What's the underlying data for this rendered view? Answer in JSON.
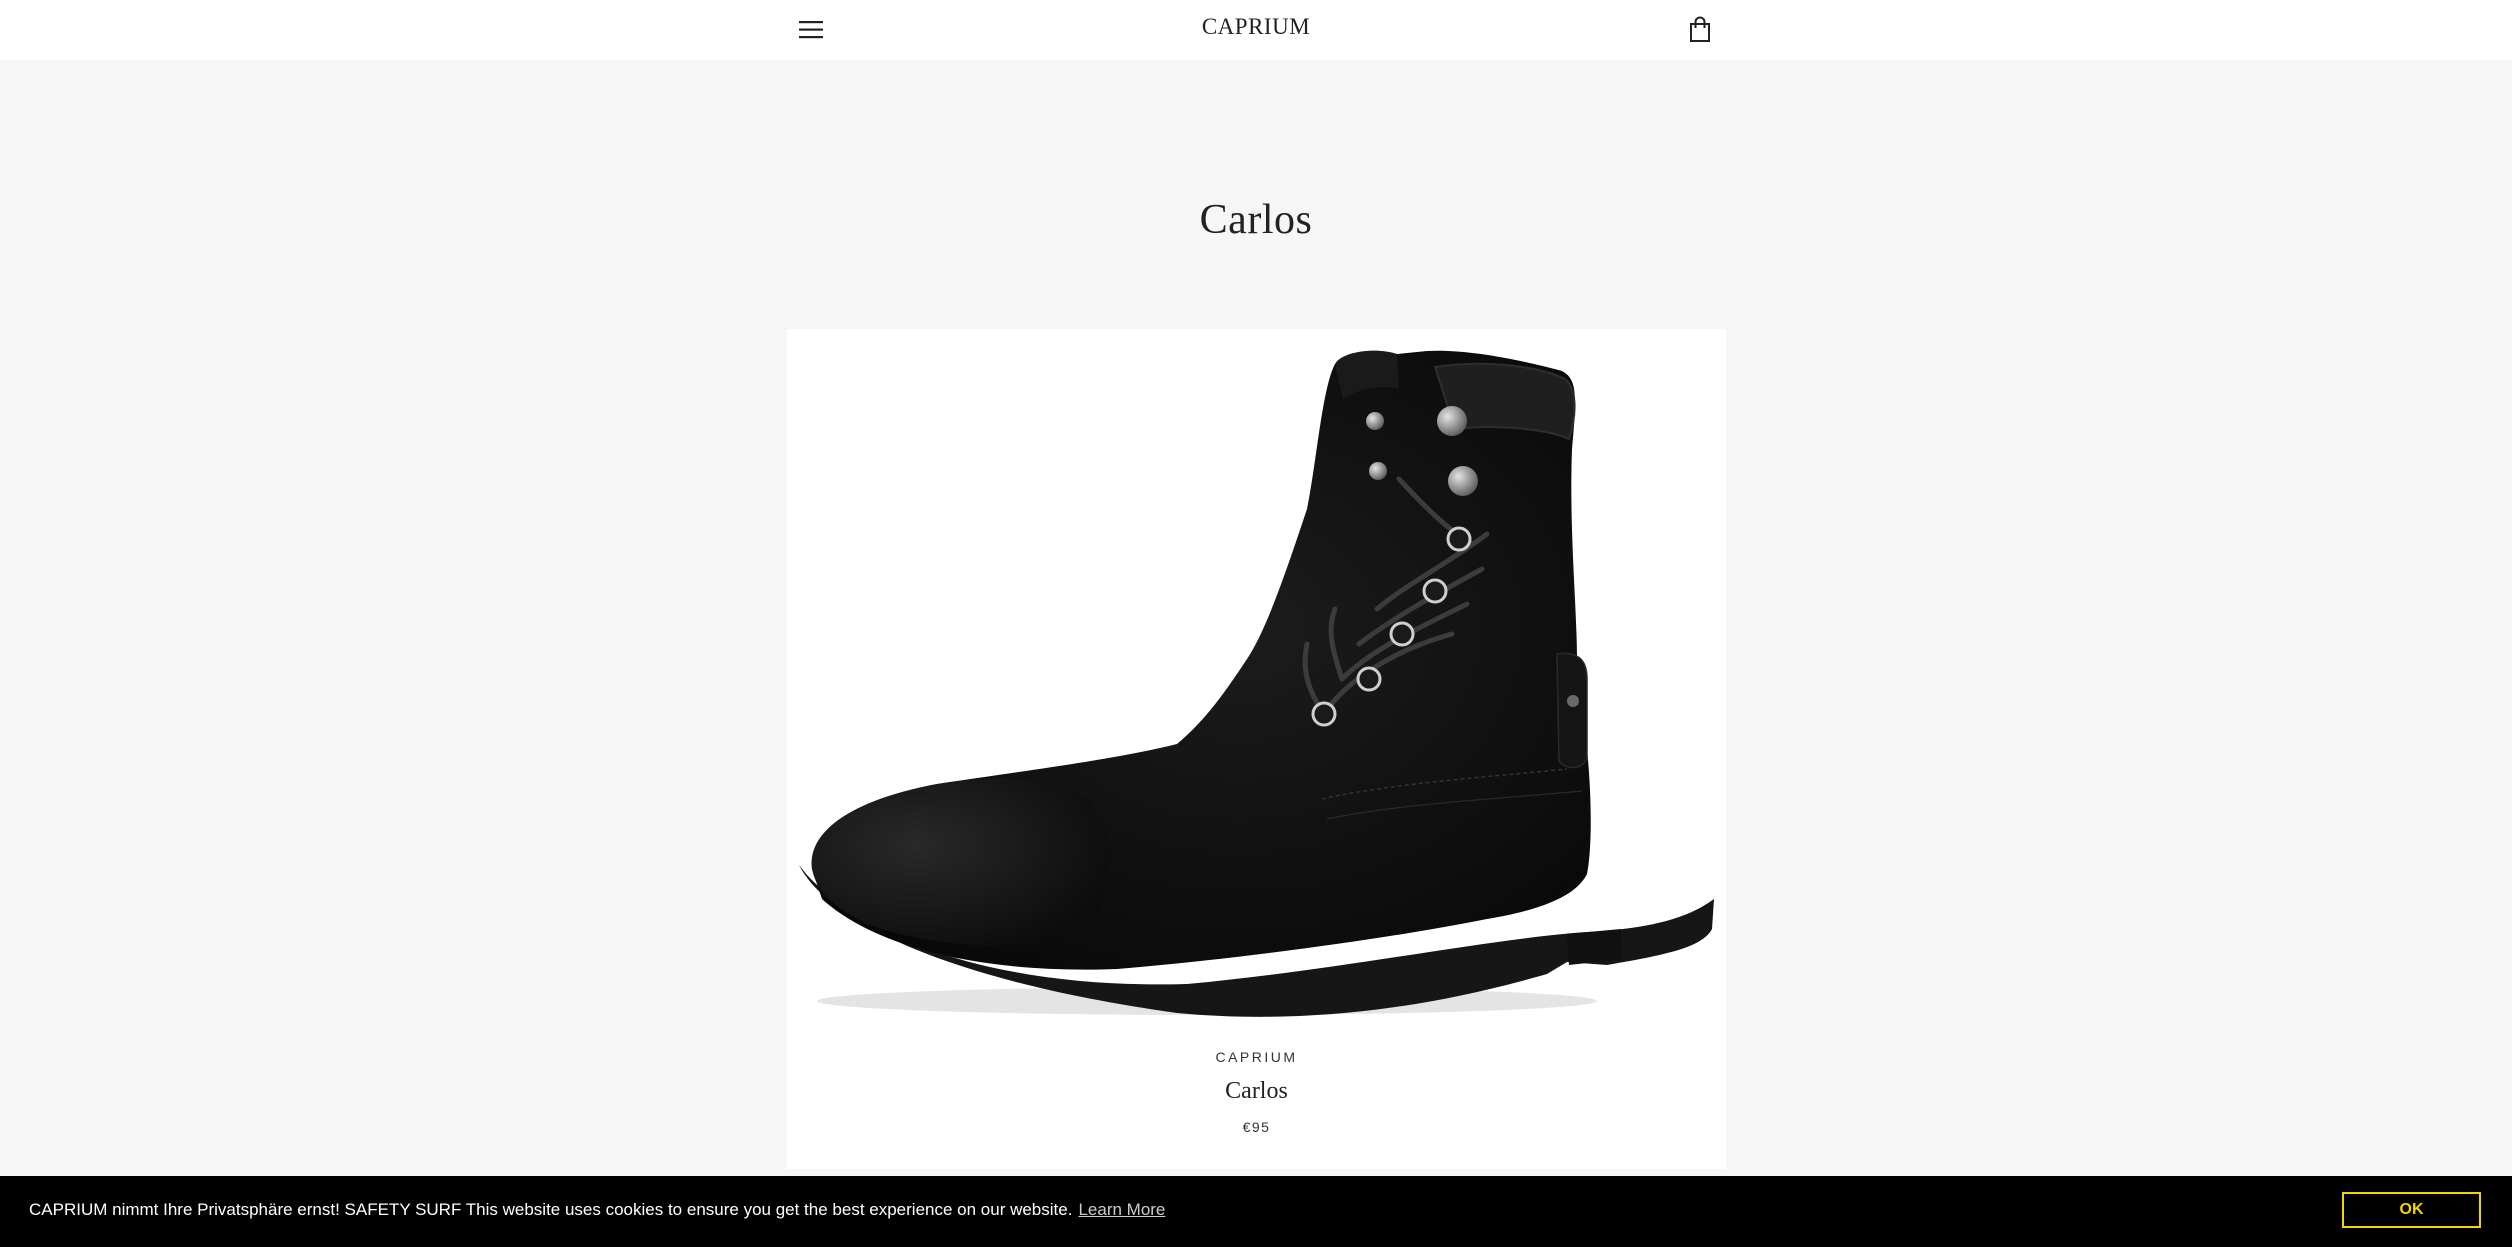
{
  "header": {
    "logo": "CAPRIUM",
    "menu_icon": "hamburger-menu-icon",
    "cart_icon": "shopping-bag-icon"
  },
  "collection": {
    "title": "Carlos"
  },
  "products": [
    {
      "vendor": "CAPRIUM",
      "name": "Carlos",
      "price": "€95",
      "image": "black suede lace-up ankle boot"
    }
  ],
  "cookie_banner": {
    "text": "CAPRIUM nimmt Ihre Privatsphäre ernst! SAFETY SURF This website uses cookies to ensure you get the best experience on our website.",
    "link": "Learn More",
    "button": "OK",
    "accent_color": "#f1d600",
    "background_color": "#000000"
  },
  "colors": {
    "page_background": "#f6f6f6",
    "header_background": "#ffffff",
    "text": "#222222"
  }
}
